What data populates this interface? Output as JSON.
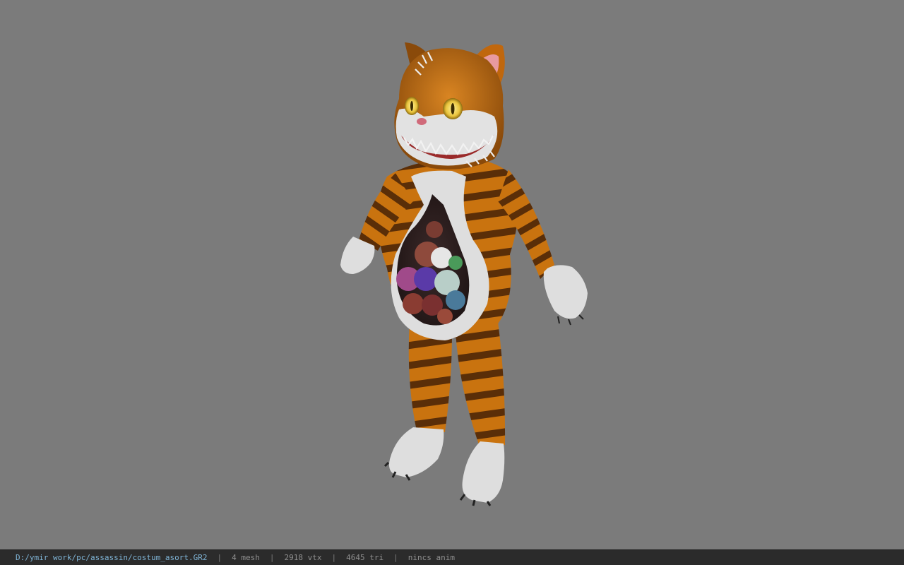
{
  "viewport": {
    "background": "#7b7b7b",
    "subject": "cat-costume-model"
  },
  "status_bar": {
    "file_path": "D:/ymir work/pc/assassin/costum_asort.GR2",
    "mesh_count": "4 mesh",
    "vertex_count": "2918 vtx",
    "triangle_count": "4645 tri",
    "anim_status": "nincs anim",
    "separator": "|"
  },
  "colors": {
    "fur_orange": "#c9730f",
    "fur_stripe": "#5a2e08",
    "fur_white": "#dedede",
    "eye_yellow": "#e8d24a",
    "mouth_red": "#9a2a2a",
    "status_bg": "#2b2b2b",
    "path_text": "#7fb4d6"
  }
}
